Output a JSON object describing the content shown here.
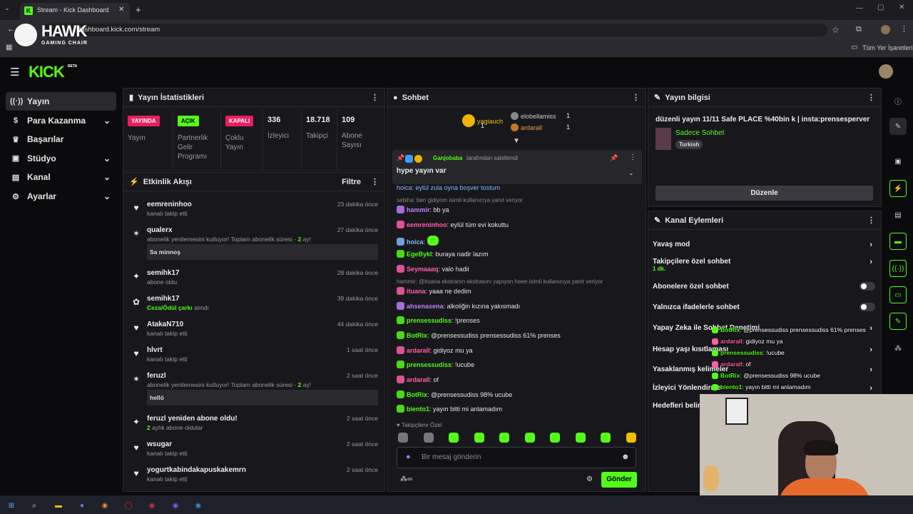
{
  "browser": {
    "tab_title": "Stream - Kick Dashboard",
    "url": "dashboard.kick.com/stream",
    "bookmarks_label": "Tüm Yer İşaretleri"
  },
  "overlay": {
    "brand": "HAWK",
    "brand_sub": "GAMING CHAIR"
  },
  "app": {
    "logo": "KICK",
    "logo_beta": "BETA"
  },
  "sidebar": {
    "items": [
      {
        "label": "Yayın",
        "icon": "broadcast-icon",
        "active": true
      },
      {
        "label": "Para Kazanma",
        "icon": "dollar-icon",
        "expand": true
      },
      {
        "label": "Başarılar",
        "icon": "trophy-icon"
      },
      {
        "label": "Stüdyo",
        "icon": "studio-icon",
        "expand": true
      },
      {
        "label": "Kanal",
        "icon": "channel-icon",
        "expand": true
      },
      {
        "label": "Ayarlar",
        "icon": "gear-icon",
        "expand": true
      }
    ]
  },
  "stats": {
    "title": "Yayın İstatistikleri",
    "cols": [
      {
        "badge": "YAYINDA",
        "badge_color": "#e91e63",
        "label": "Yayın"
      },
      {
        "badge": "AÇIK",
        "badge_color": "#53fc18",
        "label": "Partnerlik Gelir Programı"
      },
      {
        "badge": "KAPALI",
        "badge_color": "#e91e63",
        "label": "Çoklu Yayın"
      },
      {
        "value": "336",
        "label": "İzleyici"
      },
      {
        "value": "18.718",
        "label": "Takipçi"
      },
      {
        "value": "109",
        "label": "Abone Sayısı"
      }
    ]
  },
  "feed": {
    "title": "Etkinlik Akışı",
    "filter": "Filtre",
    "rows": [
      {
        "name": "eemreninhoo",
        "sub": "kanalı takip etti",
        "time": "23 dakika önce",
        "icon": "heart-icon"
      },
      {
        "name": "qualerx",
        "sub": "abonelik yenilemesini kutluyor! Toplam abonelik süresi -",
        "sub_hl": "2",
        "sub2": "ay!",
        "time": "27 dakika önce",
        "icon": "confetti-icon",
        "box": "Sa minnoş"
      },
      {
        "name": "semihk17",
        "sub": "abone oldu",
        "time": "28 dakika önce",
        "icon": "sparkle-icon"
      },
      {
        "name": "semihk17",
        "sub_hl_first": "Ceza/Ödül çarkı",
        "sub": "alındı",
        "time": "39 dakika önce",
        "icon": "wheel-icon"
      },
      {
        "name": "AtakaN710",
        "sub": "kanalı takip etti",
        "time": "44 dakika önce",
        "icon": "heart-icon"
      },
      {
        "name": "hlvrt",
        "sub": "kanalı takip etti",
        "time": "1 saat önce",
        "icon": "heart-icon"
      },
      {
        "name": "feruzl",
        "sub": "abonelik yenilemesini kutluyor! Toplam abonelik süresi -",
        "sub_hl": "2",
        "sub2": "ay!",
        "time": "2 saat önce",
        "icon": "confetti-icon",
        "box": "hellö"
      },
      {
        "name": "feruzl yeniden abone oldu!",
        "sub_hl_first": "2",
        "sub": "aylık abone oldular",
        "time": "2 saat önce",
        "icon": "sparkle-icon"
      },
      {
        "name": "wsugar",
        "sub": "kanalı takip etti",
        "time": "2 saat önce",
        "icon": "heart-icon"
      },
      {
        "name": "yogurtkabindakapuskakemrn",
        "sub": "kanalı takip etti",
        "time": "2 saat önce",
        "icon": "heart-icon"
      }
    ]
  },
  "chat": {
    "title": "Sohbet",
    "top": [
      {
        "name": "yagiauch",
        "count": "1"
      },
      {
        "name": "elobellamiss",
        "count": "1"
      },
      {
        "name": "ardarall",
        "count": "1"
      }
    ],
    "pinned": {
      "by": "Ganjobaba",
      "by_suffix": "tarafından sabitlendi",
      "text": "hype yayın var"
    },
    "cutoff": "hoica: eylül zula oyna boşver tostum",
    "lines": [
      {
        "reply": "sebiha: ben gidiyom isimli kullanıcıya yanıt veriyor"
      },
      {
        "user": "hammir",
        "color": "#c07cff",
        "text": "bb ya",
        "b": "#ff5ea8"
      },
      {
        "user": "eemreninhoo",
        "color": "#ff5ea8",
        "text": "eylül tüm evi kokuttu"
      },
      {
        "user": "hoica",
        "color": "#7fb6ff",
        "text": "",
        "emote": true
      },
      {
        "user": "EgeBykl",
        "color": "#53fc18",
        "text": "buraya nadir lazım"
      },
      {
        "user": "Seymaaaq",
        "color": "#ff5ea8",
        "text": "valo hadii"
      },
      {
        "reply": "hammir: @ituana ekstranın ekstrasını yapıyon heee isimli kullanıcıya yanıt veriyor"
      },
      {
        "user": "ituana",
        "color": "#ff5ea8",
        "text": "yaaa ne dedim"
      },
      {
        "user": "ahsenasena",
        "color": "#c07cff",
        "text": "alkoliğin kızına yakısmadı"
      },
      {
        "user": "prensessudiss",
        "color": "#53fc18",
        "text": "!prenses"
      },
      {
        "user": "BotRix",
        "color": "#53fc18",
        "text": "@prensessudiss prensessudiss 61% prenses"
      },
      {
        "user": "ardarall",
        "color": "#ff5ea8",
        "text": "gidiyoz mu ya"
      },
      {
        "user": "prensessudiss",
        "color": "#53fc18",
        "text": "!ucube"
      },
      {
        "user": "ardarall",
        "color": "#ff5ea8",
        "text": "of"
      },
      {
        "user": "BotRix",
        "color": "#53fc18",
        "text": "@prensessudiss 98% ucube"
      },
      {
        "user": "biento1",
        "color": "#53fc18",
        "text": "yayın bitti mi anlamadım"
      }
    ],
    "followers_label": "Takipçilere Özel",
    "placeholder": "Bir mesaj gönderin",
    "send": "Gönder"
  },
  "info": {
    "title": "Yayın bilgisi",
    "stream_title": "düzenli yayın 11/11 Safe PLACE %40bin k | insta:prensesperver",
    "category": "Sadece Sohbet",
    "lang": "Turkish",
    "edit": "Düzenle"
  },
  "actions": {
    "title": "Kanal Eylemleri",
    "rows": [
      {
        "label": "Yavaş mod",
        "type": "chev"
      },
      {
        "label": "Takipçilere özel sohbet",
        "sub": "1 dk.",
        "type": "chev"
      },
      {
        "label": "Abonelere özel sohbet",
        "type": "toggle"
      },
      {
        "label": "Yalnızca ifadelerle sohbet",
        "type": "toggle"
      },
      {
        "label": "Yapay Zeka ile Sohbet Denetimi",
        "type": "chev"
      },
      {
        "label": "Hesap yaşı kısıtlaması",
        "type": "chev"
      },
      {
        "label": "Yasaklanmış kelimeler",
        "type": "chev"
      },
      {
        "label": "İzleyici Yönlendirme",
        "type": "chev"
      },
      {
        "label": "Hedefleri belirle",
        "type": "chev"
      }
    ]
  },
  "overlay_chat": [
    {
      "user": "BotRix",
      "color": "#53fc18",
      "text": "@prensessudiss prensessudiss 61% prenses"
    },
    {
      "user": "ardarall",
      "color": "#ff5ea8",
      "text": "gidiyoz mu ya"
    },
    {
      "user": "prensessudiss",
      "color": "#53fc18",
      "text": "!ucube"
    },
    {
      "user": "ardarall",
      "color": "#ff5ea8",
      "text": "of"
    },
    {
      "user": "BotRix",
      "color": "#53fc18",
      "text": "@prensessudiss 98% ucube"
    },
    {
      "user": "biento1",
      "color": "#53fc18",
      "text": "yayın bitti mi anlamadım"
    }
  ],
  "colors": {
    "accent": "#53fc18",
    "pink": "#e91e63"
  }
}
